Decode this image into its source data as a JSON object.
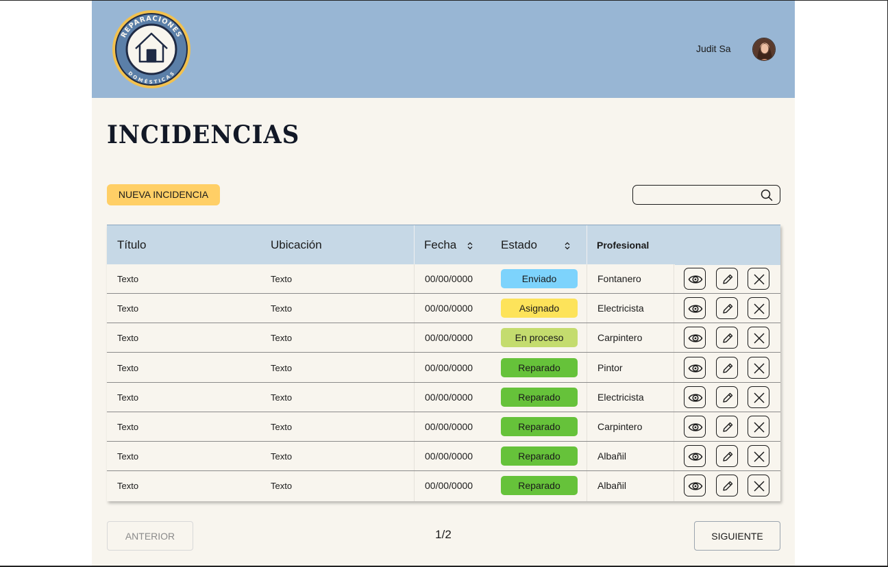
{
  "header": {
    "logo": {
      "top_text": "REPARACIONES",
      "bottom_text": "DOMÉSTICAS",
      "icon": "house-icon"
    },
    "user_name": "Judit Sa"
  },
  "page": {
    "title": "INCIDENCIAS",
    "new_button_label": "NUEVA INCIDENCIA",
    "search_placeholder": "",
    "search_icon": "search-icon"
  },
  "table": {
    "columns": {
      "title": "Título",
      "location": "Ubicación",
      "date": "Fecha",
      "status": "Estado",
      "professional": "Profesional"
    },
    "rows": [
      {
        "title": "Texto",
        "location": "Texto",
        "date": "00/00/0000",
        "status": "Enviado",
        "status_color": "#7dd3fc",
        "professional": "Fontanero"
      },
      {
        "title": "Texto",
        "location": "Texto",
        "date": "00/00/0000",
        "status": "Asignado",
        "status_color": "#fde35a",
        "professional": "Electricista"
      },
      {
        "title": "Texto",
        "location": "Texto",
        "date": "00/00/0000",
        "status": "En proceso",
        "status_color": "#c4dc6e",
        "professional": "Carpintero"
      },
      {
        "title": "Texto",
        "location": "Texto",
        "date": "00/00/0000",
        "status": "Reparado",
        "status_color": "#66c23a",
        "professional": "Pintor"
      },
      {
        "title": "Texto",
        "location": "Texto",
        "date": "00/00/0000",
        "status": "Reparado",
        "status_color": "#66c23a",
        "professional": "Electricista"
      },
      {
        "title": "Texto",
        "location": "Texto",
        "date": "00/00/0000",
        "status": "Reparado",
        "status_color": "#66c23a",
        "professional": "Carpintero"
      },
      {
        "title": "Texto",
        "location": "Texto",
        "date": "00/00/0000",
        "status": "Reparado",
        "status_color": "#66c23a",
        "professional": "Albañil"
      },
      {
        "title": "Texto",
        "location": "Texto",
        "date": "00/00/0000",
        "status": "Reparado",
        "status_color": "#66c23a",
        "professional": "Albañil"
      }
    ],
    "row_actions": [
      "eye-icon",
      "pencil-icon",
      "close-icon"
    ]
  },
  "pagination": {
    "prev_label": "ANTERIOR",
    "page_indicator": "1/2",
    "next_label": "SIGUIENTE"
  },
  "colors": {
    "header_bg": "#98b6d4",
    "page_bg": "#f8f5ee",
    "table_header_bg": "#c6d8e6",
    "primary_button": "#ffcf66"
  }
}
